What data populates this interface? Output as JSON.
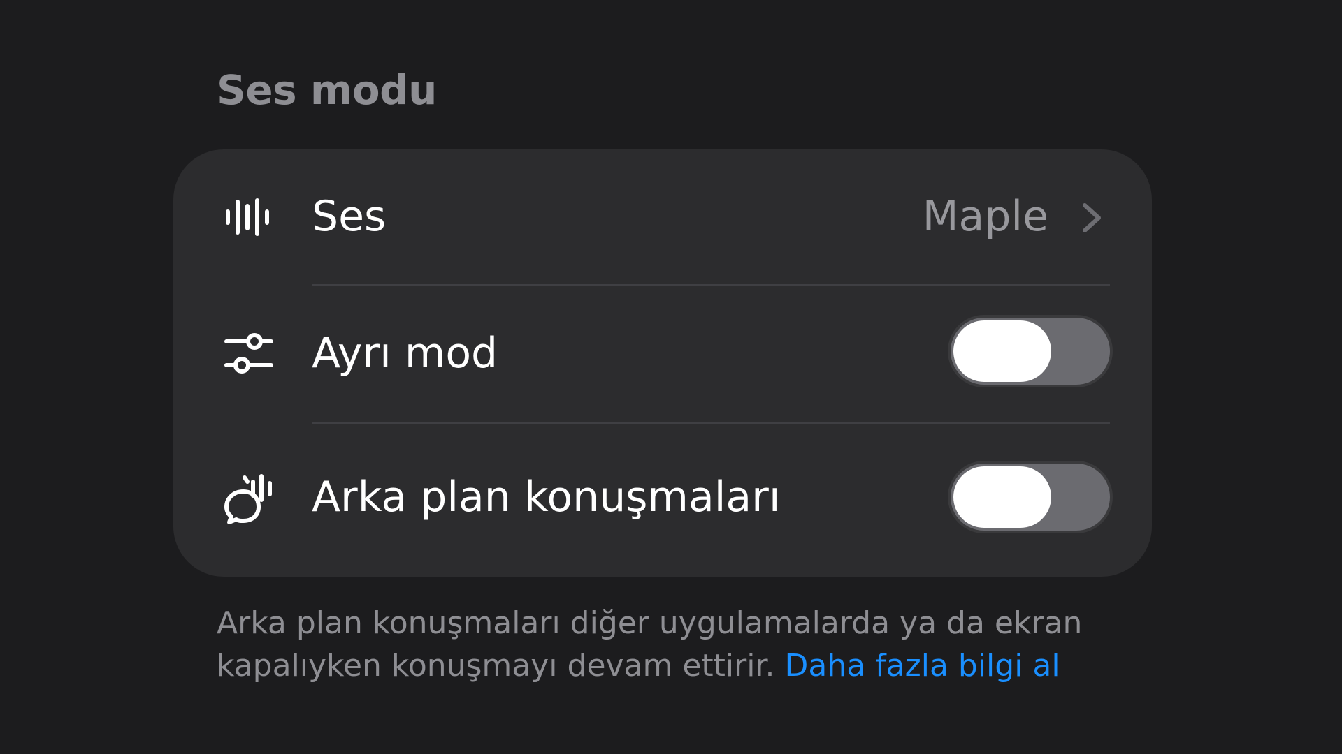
{
  "section": {
    "title": "Ses modu"
  },
  "rows": [
    {
      "label": "Ses",
      "value": "Maple",
      "icon": "waveform-icon"
    },
    {
      "label": "Ayrı mod",
      "icon": "sliders-icon",
      "toggle_on": false
    },
    {
      "label": "Arka plan konuşmaları",
      "icon": "background-chat-icon",
      "toggle_on": false
    }
  ],
  "footer": {
    "text": "Arka plan konuşmaları diğer uygulamalarda ya da ekran kapalıyken konuşmayı devam ettirir. ",
    "link": "Daha fazla bilgi al"
  },
  "colors": {
    "background": "#1c1c1e",
    "card": "#2c2c2e",
    "link": "#1a8fff",
    "secondary_text": "#8e8e93"
  }
}
